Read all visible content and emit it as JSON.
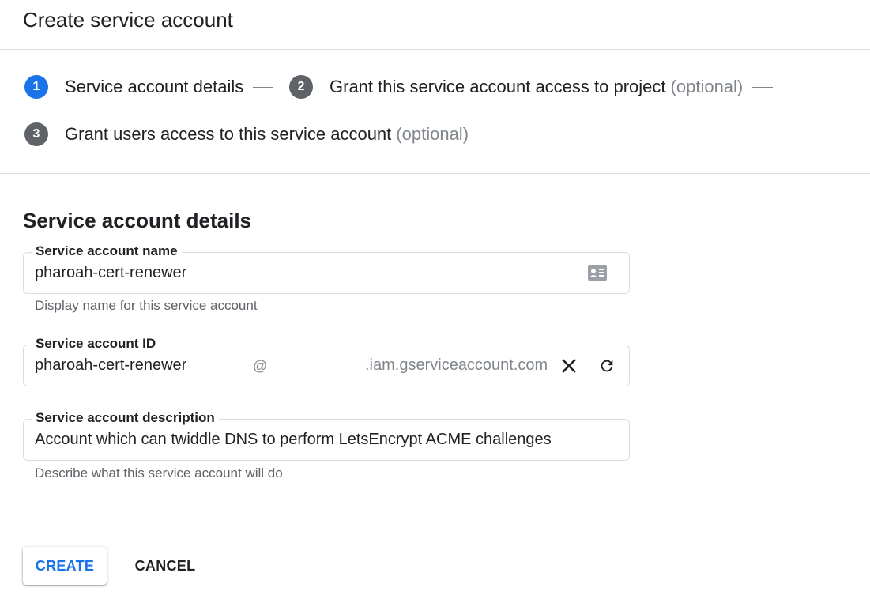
{
  "header": {
    "title": "Create service account"
  },
  "stepper": {
    "steps": [
      {
        "number": "1",
        "label": "Service account details",
        "optional": "",
        "state": "active"
      },
      {
        "number": "2",
        "label": "Grant this service account access to project",
        "optional": "(optional)",
        "state": "inactive"
      },
      {
        "number": "3",
        "label": "Grant users access to this service account",
        "optional": "(optional)",
        "state": "inactive"
      }
    ]
  },
  "form": {
    "section_title": "Service account details",
    "name_field": {
      "label": "Service account name",
      "value": "pharoah-cert-renewer",
      "hint": "Display name for this service account",
      "icon": "contact-card-icon"
    },
    "id_field": {
      "label": "Service account ID",
      "value": "pharoah-cert-renewer",
      "at": "@",
      "domain_suffix": ".iam.gserviceaccount.com",
      "clear_icon": "close-icon",
      "refresh_icon": "refresh-icon"
    },
    "description_field": {
      "label": "Service account description",
      "value": "Account which can twiddle DNS to perform LetsEncrypt ACME challenges",
      "hint": "Describe what this service account will do"
    }
  },
  "actions": {
    "create_label": "CREATE",
    "cancel_label": "CANCEL"
  },
  "colors": {
    "accent": "#1a73e8",
    "step_inactive": "#5f6368",
    "border": "#dadce0",
    "muted_text": "#5f6368"
  }
}
